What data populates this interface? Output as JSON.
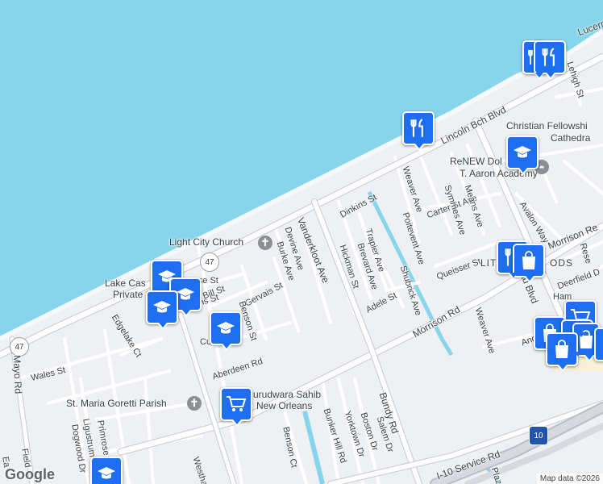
{
  "colors": {
    "water": "#87d5ed",
    "land": "#eef0f3",
    "road_major": "#ffffff",
    "road_minor": "#ffffff",
    "road_outline": "#c5cad1",
    "canal": "#87d5ed",
    "marker": "#1d6ef0"
  },
  "streets": {
    "lincoln_bch_blvd": "Lincoln Bch Blvd",
    "vanderkloot_ave": "Vanderkloot Ave",
    "morrison_rd": "Morrison Rd",
    "morrison_rd_2": "Morrison Rd",
    "bundy_rd": "Bundy Rd",
    "i10_service_rd": "I-10 Service Rd",
    "mayo_rd": "Mayo Rd",
    "wales_st": "Wales St",
    "edgelake_ct": "Edgelake Ct",
    "aberdeen_rd": "Aberdeen Rd",
    "dinkins_st": "Dinkins St",
    "dinkins_st_2": "Dinkins St",
    "gervais_st": "Gervais St",
    "benson_st": "Benson St",
    "benson_ct": "Benson Ct",
    "bill_st": "Bill St",
    "rose_st": "rose St",
    "cu_st": "Cu",
    "burke_ave": "Burke Ave",
    "devine_ave": "Devine Ave",
    "hickman_st": "Hickman St",
    "brevard_ave": "Brevard Ave",
    "trapier_ave": "Trapier Ave",
    "adele_st": "Adele St",
    "shubrick_ave": "Shubrick Ave",
    "poitevent_ave": "Poitevent Ave",
    "weaver_ave": "Weaver Ave",
    "weaver_ave_2": "Weaver Ave",
    "carter_st": "Carter St Ave",
    "symmes_ave": "Symmes Ave",
    "means_ave": "Means Ave",
    "quiesser_st": "Queisser St",
    "avalon_way": "Avalon Way",
    "lehigh_st": "Lehigh St",
    "lucerne": "Lucern",
    "andover": "Andove",
    "deerfield": "Deerfield D",
    "ham": "Ham",
    "rese": "Rese",
    "morrison_rd_3": "Morrison Re",
    "head_blvd": "ead Blvd",
    "salem_dr": "Salem Dr",
    "boston_dr": "Boston Dr",
    "yorktown_dr": "Yorktown Dr",
    "bunker_hill_rd": "Bunker Hill Rd",
    "westhaven": "Westhav",
    "primrose": "Primrose",
    "ligustrum": "Ligustrum",
    "dogwood": "Dogwood Dr",
    "fields": "Field",
    "ea": "Ea",
    "plaza": "Plaza"
  },
  "places": {
    "light_city_church": "Light City Church",
    "christian_fellowship": "Christian Fellowshi",
    "cathedral": "Cathedra",
    "renew": "ReNEW Dol",
    "aaron_academy": "T. Aaron Academy",
    "lake_castle": "Lake Cas",
    "private_school": "Private Sch",
    "st_maria": "St. Maria Goretti Parish",
    "gurudwara1": "urudwara Sahib",
    "gurudwara2": "New Orleans",
    "little_woods_a": "LIT",
    "little_woods_b": "ODS"
  },
  "shields": {
    "r47a": "47",
    "r47b": "47",
    "i10": "10"
  },
  "attribution": {
    "logo": "Google",
    "text": "Map data ©2026"
  }
}
